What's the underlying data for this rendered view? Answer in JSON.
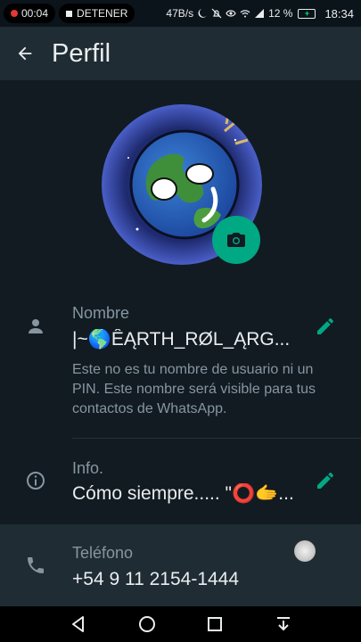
{
  "status_bar": {
    "record_time": "00:04",
    "stop_label": "DETENER",
    "network_speed": "47B/s",
    "battery_percent": "12 %",
    "battery_level": "",
    "clock": "18:34"
  },
  "header": {
    "title": "Perfil"
  },
  "name_row": {
    "label": "Nombre",
    "value": "|~🌎ÊĄRTH_RØL_ĄRG...",
    "note": "Este no es tu nombre de usuario ni un PIN. Este nombre será visible para tus contactos de WhatsApp."
  },
  "info_row": {
    "label": "Info.",
    "value": "Cómo siempre..... \"⭕🫱..."
  },
  "phone_row": {
    "label": "Teléfono",
    "value": "+54 9 11 2154-1444"
  },
  "colors": {
    "accent": "#00a884",
    "background": "#121b22",
    "header": "#1f2c34"
  },
  "icons": {
    "back": "arrow-left-icon",
    "camera": "camera-icon",
    "person": "person-icon",
    "info": "info-icon",
    "phone": "phone-icon",
    "edit": "pencil-icon"
  }
}
